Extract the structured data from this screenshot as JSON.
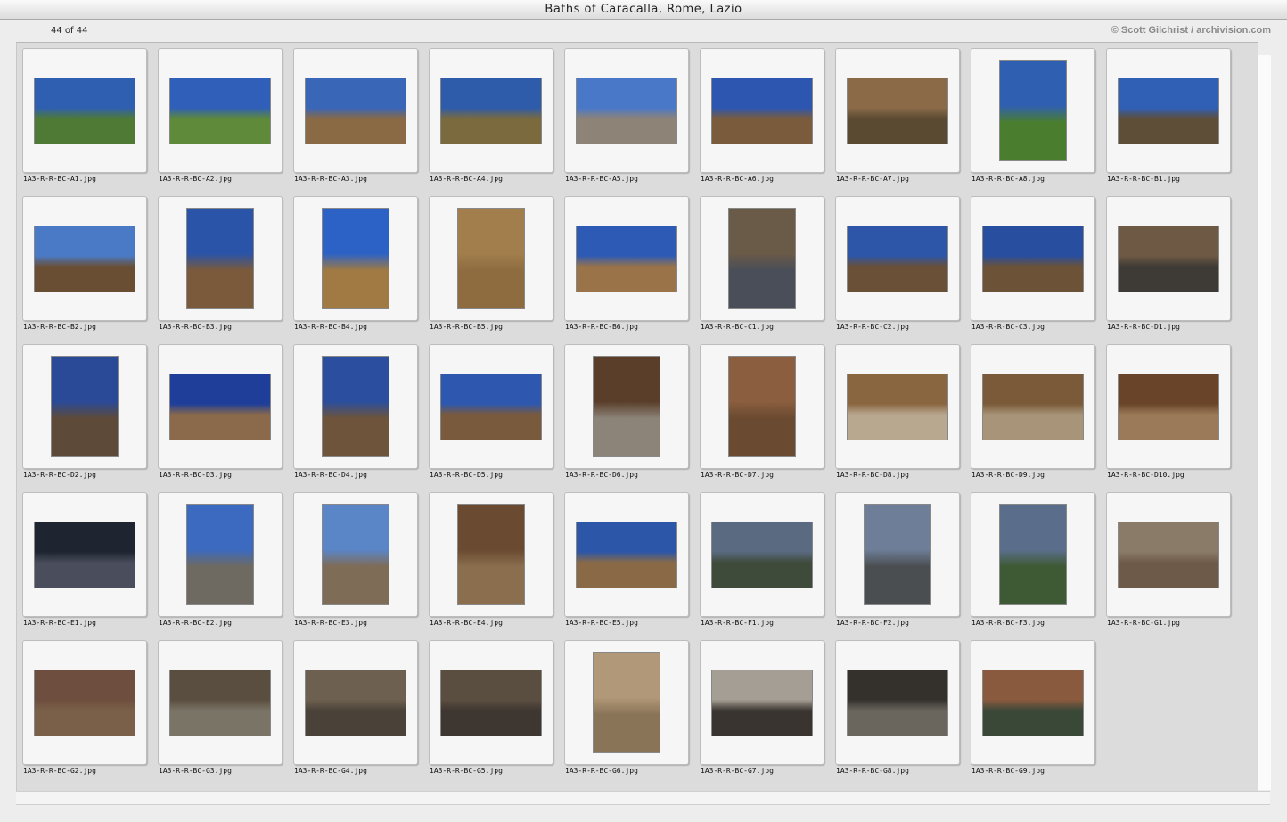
{
  "window": {
    "title": "Baths of Caracalla, Rome, Lazio"
  },
  "header": {
    "count": "44 of 44",
    "copyright": "© Scott Gilchrist / archivision.com"
  },
  "thumbnails": [
    {
      "file": "1A3-R-R-BC-A1.jpg",
      "orientation": "landscape",
      "top": "#2f5fb0",
      "bottom": "#4f7a36"
    },
    {
      "file": "1A3-R-R-BC-A2.jpg",
      "orientation": "landscape",
      "top": "#2f5fb8",
      "bottom": "#5f8a3a"
    },
    {
      "file": "1A3-R-R-BC-A3.jpg",
      "orientation": "landscape",
      "top": "#3a66b8",
      "bottom": "#8a6a44"
    },
    {
      "file": "1A3-R-R-BC-A4.jpg",
      "orientation": "landscape",
      "top": "#2e5caa",
      "bottom": "#7a6a3e"
    },
    {
      "file": "1A3-R-R-BC-A5.jpg",
      "orientation": "landscape",
      "top": "#4a78c8",
      "bottom": "#8d8376"
    },
    {
      "file": "1A3-R-R-BC-A6.jpg",
      "orientation": "landscape",
      "top": "#2d56b0",
      "bottom": "#7a5c3c"
    },
    {
      "file": "1A3-R-R-BC-A7.jpg",
      "orientation": "landscape",
      "top": "#8b6a48",
      "bottom": "#5a4a32"
    },
    {
      "file": "1A3-R-R-BC-A8.jpg",
      "orientation": "portrait",
      "top": "#2f5fb0",
      "bottom": "#4a7e2e"
    },
    {
      "file": "1A3-R-R-BC-B1.jpg",
      "orientation": "landscape",
      "top": "#3060b6",
      "bottom": "#5e4e38"
    },
    {
      "file": "1A3-R-R-BC-B2.jpg",
      "orientation": "landscape",
      "top": "#4a7ac6",
      "bottom": "#6a4e34"
    },
    {
      "file": "1A3-R-R-BC-B3.jpg",
      "orientation": "portrait",
      "top": "#2a54a8",
      "bottom": "#7a5a3a"
    },
    {
      "file": "1A3-R-R-BC-B4.jpg",
      "orientation": "portrait",
      "top": "#2c62c6",
      "bottom": "#a07a42"
    },
    {
      "file": "1A3-R-R-BC-B5.jpg",
      "orientation": "portrait",
      "top": "#a27e4c",
      "bottom": "#8e6c40"
    },
    {
      "file": "1A3-R-R-BC-B6.jpg",
      "orientation": "landscape",
      "top": "#2d5ab4",
      "bottom": "#9a7448"
    },
    {
      "file": "1A3-R-R-BC-C1.jpg",
      "orientation": "portrait",
      "top": "#6a5a48",
      "bottom": "#4a4e58"
    },
    {
      "file": "1A3-R-R-BC-C2.jpg",
      "orientation": "landscape",
      "top": "#2d56a8",
      "bottom": "#6a5036"
    },
    {
      "file": "1A3-R-R-BC-C3.jpg",
      "orientation": "landscape",
      "top": "#284ea0",
      "bottom": "#6c5236"
    },
    {
      "file": "1A3-R-R-BC-D1.jpg",
      "orientation": "landscape",
      "top": "#6e5a44",
      "bottom": "#3e3a36"
    },
    {
      "file": "1A3-R-R-BC-D2.jpg",
      "orientation": "portrait",
      "top": "#2a4a98",
      "bottom": "#5e4a38"
    },
    {
      "file": "1A3-R-R-BC-D3.jpg",
      "orientation": "landscape",
      "top": "#1e3e9a",
      "bottom": "#8a6a4a"
    },
    {
      "file": "1A3-R-R-BC-D4.jpg",
      "orientation": "portrait",
      "top": "#2c4e9e",
      "bottom": "#6e543a"
    },
    {
      "file": "1A3-R-R-BC-D5.jpg",
      "orientation": "landscape",
      "top": "#2e58b0",
      "bottom": "#7a5a3c"
    },
    {
      "file": "1A3-R-R-BC-D6.jpg",
      "orientation": "portrait",
      "top": "#5a3e2a",
      "bottom": "#8c8478"
    },
    {
      "file": "1A3-R-R-BC-D7.jpg",
      "orientation": "portrait",
      "top": "#8a5e3e",
      "bottom": "#6a4a30"
    },
    {
      "file": "1A3-R-R-BC-D8.jpg",
      "orientation": "landscape",
      "top": "#8a6640",
      "bottom": "#b8a890"
    },
    {
      "file": "1A3-R-R-BC-D9.jpg",
      "orientation": "landscape",
      "top": "#7a5a38",
      "bottom": "#a89478"
    },
    {
      "file": "1A3-R-R-BC-D10.jpg",
      "orientation": "landscape",
      "top": "#6a4428",
      "bottom": "#9a7a58"
    },
    {
      "file": "1A3-R-R-BC-E1.jpg",
      "orientation": "landscape",
      "top": "#1e2430",
      "bottom": "#4a4e5c"
    },
    {
      "file": "1A3-R-R-BC-E2.jpg",
      "orientation": "portrait",
      "top": "#3c6ac0",
      "bottom": "#6e6a62"
    },
    {
      "file": "1A3-R-R-BC-E3.jpg",
      "orientation": "portrait",
      "top": "#5a86c8",
      "bottom": "#7e6c56"
    },
    {
      "file": "1A3-R-R-BC-E4.jpg",
      "orientation": "portrait",
      "top": "#6a4a30",
      "bottom": "#8a6e4e"
    },
    {
      "file": "1A3-R-R-BC-E5.jpg",
      "orientation": "landscape",
      "top": "#2c56a8",
      "bottom": "#8a6a46"
    },
    {
      "file": "1A3-R-R-BC-F1.jpg",
      "orientation": "landscape",
      "top": "#5a6a80",
      "bottom": "#3e4a3a"
    },
    {
      "file": "1A3-R-R-BC-F2.jpg",
      "orientation": "portrait",
      "top": "#6e7e98",
      "bottom": "#4a4e50"
    },
    {
      "file": "1A3-R-R-BC-F3.jpg",
      "orientation": "portrait",
      "top": "#5a6e8c",
      "bottom": "#3e5a34"
    },
    {
      "file": "1A3-R-R-BC-G1.jpg",
      "orientation": "landscape",
      "top": "#8a7a68",
      "bottom": "#6e5a48"
    },
    {
      "file": "1A3-R-R-BC-G2.jpg",
      "orientation": "landscape",
      "top": "#6e4e3e",
      "bottom": "#7a6048"
    },
    {
      "file": "1A3-R-R-BC-G3.jpg",
      "orientation": "landscape",
      "top": "#5a4e40",
      "bottom": "#7a7466"
    },
    {
      "file": "1A3-R-R-BC-G4.jpg",
      "orientation": "landscape",
      "top": "#6e6050",
      "bottom": "#4a4238"
    },
    {
      "file": "1A3-R-R-BC-G5.jpg",
      "orientation": "landscape",
      "top": "#5a4e40",
      "bottom": "#3e3630"
    },
    {
      "file": "1A3-R-R-BC-G6.jpg",
      "orientation": "portrait",
      "top": "#b09878",
      "bottom": "#8a7458"
    },
    {
      "file": "1A3-R-R-BC-G7.jpg",
      "orientation": "landscape",
      "top": "#a49e94",
      "bottom": "#3a3430"
    },
    {
      "file": "1A3-R-R-BC-G8.jpg",
      "orientation": "landscape",
      "top": "#34302c",
      "bottom": "#6a665e"
    },
    {
      "file": "1A3-R-R-BC-G9.jpg",
      "orientation": "landscape",
      "top": "#8a5a3e",
      "bottom": "#3a4838"
    }
  ]
}
